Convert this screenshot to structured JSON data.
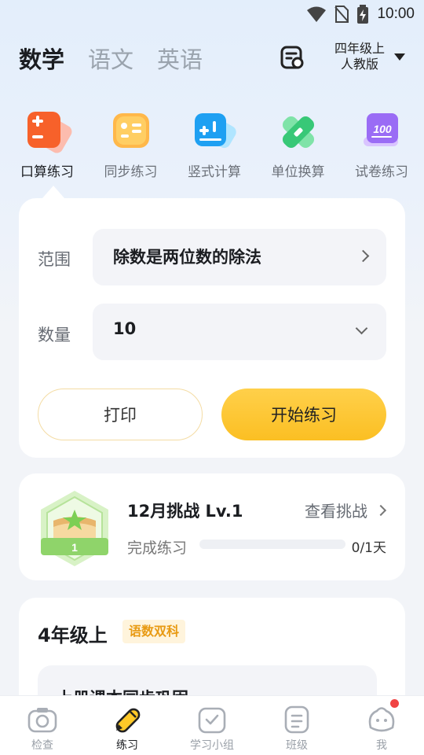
{
  "status_bar": {
    "time": "10:00",
    "icons": [
      "wifi-icon",
      "no-sim-icon",
      "battery-charging-icon"
    ]
  },
  "subjects": [
    {
      "label": "数学",
      "active": true
    },
    {
      "label": "语文",
      "active": false
    },
    {
      "label": "英语",
      "active": false
    }
  ],
  "header": {
    "scan_icon": "scan-icon",
    "grade_line1": "四年级上",
    "grade_line2": "人教版"
  },
  "tools": [
    {
      "label": "口算练习",
      "icon": "mental-math-icon",
      "active": true
    },
    {
      "label": "同步练习",
      "icon": "sync-practice-icon",
      "active": false
    },
    {
      "label": "竖式计算",
      "icon": "vertical-calc-icon",
      "active": false
    },
    {
      "label": "单位换算",
      "icon": "unit-convert-icon",
      "active": false
    },
    {
      "label": "试卷练习",
      "icon": "exam-paper-icon",
      "active": false
    }
  ],
  "practice": {
    "range_label": "范围",
    "range_value": "除数是两位数的除法",
    "count_label": "数量",
    "count_value": "10",
    "print_label": "打印",
    "start_label": "开始练习"
  },
  "challenge": {
    "title": "12月挑战 Lv.1",
    "link_label": "查看挑战",
    "sub_label": "完成练习",
    "progress_text": "0/1天",
    "progress_fraction": 0,
    "badge_level": "1"
  },
  "grade_card": {
    "title": "4年级上",
    "tag": "语数双科",
    "inner_title": "上册课本同步巩固"
  },
  "nav": [
    {
      "label": "检查",
      "icon": "camera-icon",
      "active": false
    },
    {
      "label": "练习",
      "icon": "pencil-icon",
      "active": true
    },
    {
      "label": "学习小组",
      "icon": "group-check-icon",
      "active": false
    },
    {
      "label": "班级",
      "icon": "class-icon",
      "active": false
    },
    {
      "label": "我",
      "icon": "profile-face-icon",
      "active": false
    }
  ],
  "colors": {
    "accent": "#fbbf23",
    "tag_text": "#e89a13",
    "notification": "#f04343"
  }
}
